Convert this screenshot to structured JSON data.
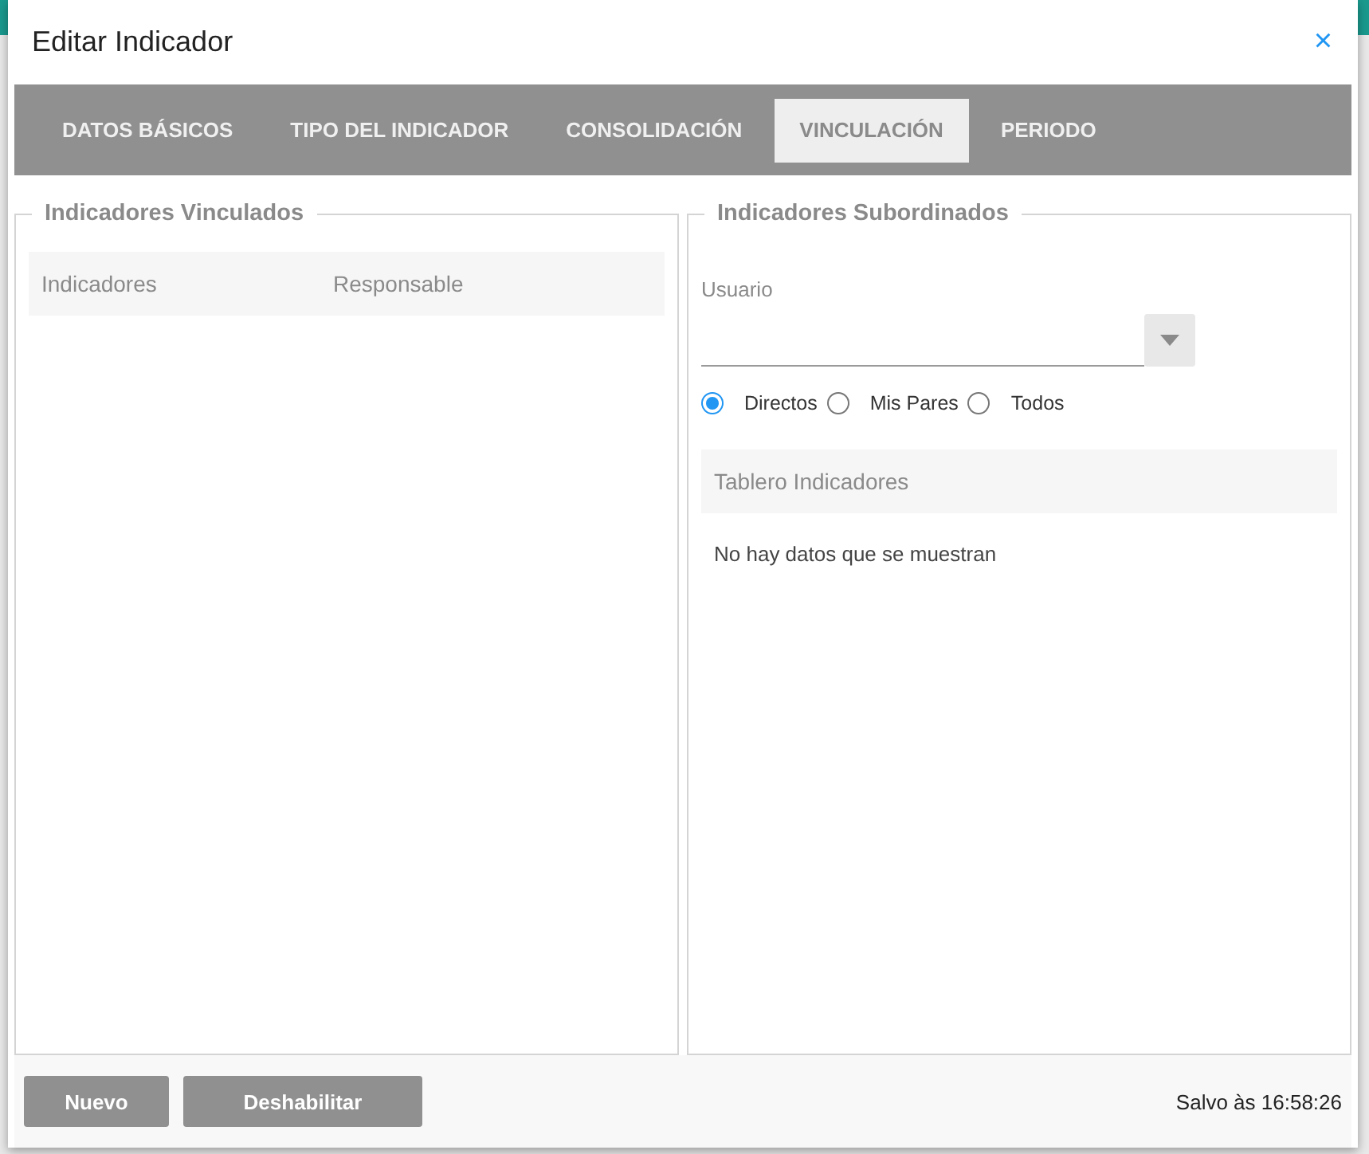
{
  "dialog": {
    "title": "Editar Indicador",
    "close": "×"
  },
  "tabs": [
    {
      "label": "DATOS BÁSICOS",
      "selected": false
    },
    {
      "label": "TIPO DEL INDICADOR",
      "selected": false
    },
    {
      "label": "CONSOLIDACIÓN",
      "selected": false
    },
    {
      "label": "VINCULACIÓN",
      "selected": true
    },
    {
      "label": "PERIODO",
      "selected": false
    }
  ],
  "linked": {
    "legend": "Indicadores Vinculados",
    "columns": [
      "Indicadores",
      "Responsable"
    ]
  },
  "subordinates": {
    "legend": "Indicadores Subordinados",
    "user_label": "Usuario",
    "scope_options": [
      {
        "label": "Directos",
        "selected": true
      },
      {
        "label": "Mis Pares",
        "selected": false
      },
      {
        "label": "Todos",
        "selected": false
      }
    ],
    "table_header": "Tablero Indicadores",
    "empty_message": "No hay datos que se muestran"
  },
  "footer": {
    "buttons": [
      "Nuevo",
      "Deshabilitar"
    ],
    "status": "Salvo às 16:58:26"
  }
}
